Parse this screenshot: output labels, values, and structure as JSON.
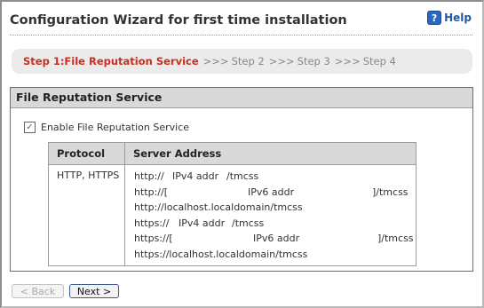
{
  "header": {
    "title": "Configuration Wizard for first time installation",
    "help_label": "Help",
    "help_icon": "question-icon"
  },
  "steps": {
    "active": "Step 1:File Reputation Service",
    "separator": ">>>",
    "step2": "Step 2",
    "step3": "Step 3",
    "step4": "Step 4"
  },
  "panel": {
    "title": "File Reputation Service",
    "enable_label": "Enable File Reputation Service",
    "enable_checked": true
  },
  "table": {
    "headers": {
      "protocol": "Protocol",
      "server": "Server Address"
    },
    "protocol": "HTTP, HTTPS",
    "addresses": [
      {
        "prefix": "http://",
        "placeholder": "IPv4 addr",
        "suffix": "/tmcss"
      },
      {
        "prefix": "http://[",
        "placeholder": "IPv6 addr",
        "suffix": "]/tmcss"
      },
      {
        "prefix": "http://localhost.localdomain/tmcss",
        "placeholder": "",
        "suffix": ""
      },
      {
        "prefix": "https://",
        "placeholder": "IPv4 addr",
        "suffix": "/tmcss"
      },
      {
        "prefix": "https://[",
        "placeholder": "IPv6 addr",
        "suffix": "]/tmcss"
      },
      {
        "prefix": "https://localhost.localdomain/tmcss",
        "placeholder": "",
        "suffix": ""
      }
    ]
  },
  "buttons": {
    "back": "< Back",
    "next": "Next >"
  }
}
